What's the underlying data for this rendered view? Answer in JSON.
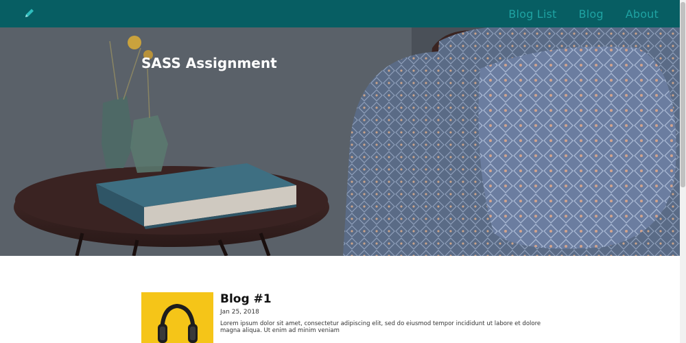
{
  "nav": {
    "logo_icon": "pencil-icon",
    "links": [
      "Blog List",
      "Blog",
      "About"
    ]
  },
  "hero": {
    "title": "SASS Assignment"
  },
  "posts": [
    {
      "title": "Blog #1",
      "date": "Jan 25, 2018",
      "excerpt": "Lorem ipsum dolor sit amet, consectetur adipiscing elit, sed do eiusmod tempor incididunt ut labore et dolore magna aliqua. Ut enim ad minim veniam",
      "thumb_icon": "headphones-icon"
    }
  ],
  "colors": {
    "navbar": "#075e63",
    "nav_link": "#1fa3a3",
    "thumb_bg": "#f5c518"
  }
}
